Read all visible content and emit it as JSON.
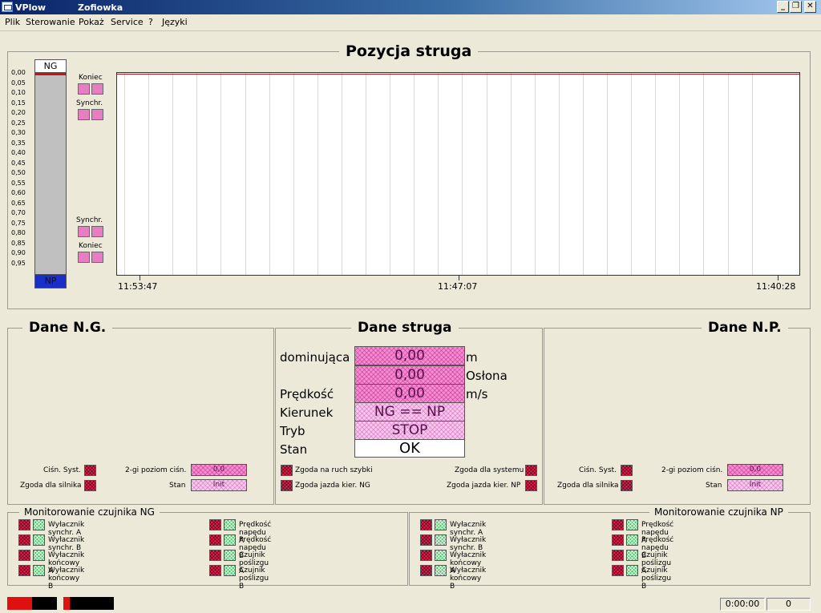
{
  "titlebar": {
    "app": "VPlow",
    "mine": "Zofiowka"
  },
  "menu": [
    "Plik",
    "Sterowanie",
    "Pokaż",
    "Service",
    "?",
    "Języki"
  ],
  "top": {
    "title": "Pozycja struga",
    "bar_top": "NG",
    "bar_bottom": "NP",
    "scale": [
      "0,00",
      "0,05",
      "0,10",
      "0,15",
      "0,20",
      "0,25",
      "0,30",
      "0,35",
      "0,40",
      "0,45",
      "0,50",
      "0,55",
      "0,60",
      "0,65",
      "0,70",
      "0,75",
      "0,80",
      "0,85",
      "0,90",
      "0,95"
    ],
    "labels": {
      "koniec": "Koniec",
      "synchr": "Synchr."
    },
    "times": [
      "11:53:47",
      "11:47:07",
      "11:40:28"
    ]
  },
  "ng": {
    "title": "Dane N.G.",
    "cisn": "Ciśn. Syst.",
    "zgoda": "Zgoda dla silnika",
    "poziom": "2-gi poziom ciśn.",
    "poziom_val": "0,0",
    "stan": "Stan",
    "stan_val": "Init"
  },
  "center": {
    "title": "Dane struga",
    "rows": [
      {
        "label": "dominująca",
        "value": "0,00",
        "unit": "m"
      },
      {
        "label": "",
        "value": "0,00",
        "unit": "Osłona"
      },
      {
        "label": "Prędkość",
        "value": "0,00",
        "unit": "m/s"
      },
      {
        "label": "Kierunek",
        "value": "NG == NP",
        "unit": ""
      },
      {
        "label": "Tryb",
        "value": "STOP",
        "unit": ""
      },
      {
        "label": "Stan",
        "value": "OK",
        "unit": ""
      }
    ],
    "zgoda_ruch": "Zgoda na ruch szybki",
    "zgoda_jazda_ng": "Zgoda jazda kier. NG",
    "zgoda_systemu": "Zgoda dla systemu",
    "zgoda_jazda_np": "Zgoda jazda kier. NP"
  },
  "np": {
    "title": "Dane N.P.",
    "cisn": "Ciśn. Syst.",
    "zgoda": "Zgoda dla silnika",
    "poziom": "2-gi poziom ciśn.",
    "poziom_val": "0,0",
    "stan": "Stan",
    "stan_val": "Init"
  },
  "mon_ng": {
    "title": "Monitorowanie czujnika NG",
    "left": [
      "Wyłacznik synchr. A",
      "Wyłacznik synchr. B",
      "Wyłacznik końcowy A",
      "Wyłacznik końcowy B"
    ],
    "right": [
      "Prędkość napędu A",
      "Prędkość napędu B",
      "Czujnik poślizgu A",
      "Czujnik poślizgu B"
    ]
  },
  "mon_np": {
    "title": "Monitorowanie czujnika NP",
    "left": [
      "Wyłacznik synchr. A",
      "Wyłacznik synchr. B",
      "Wyłacznik końcowy A",
      "Wyłacznik końcowy B"
    ],
    "right": [
      "Prędkość napędu A",
      "Prędkość napędu B",
      "Czujnik poślizgu A",
      "Czujnik poślizgu B"
    ]
  },
  "status": {
    "time": "0:00:00",
    "count": "0"
  }
}
